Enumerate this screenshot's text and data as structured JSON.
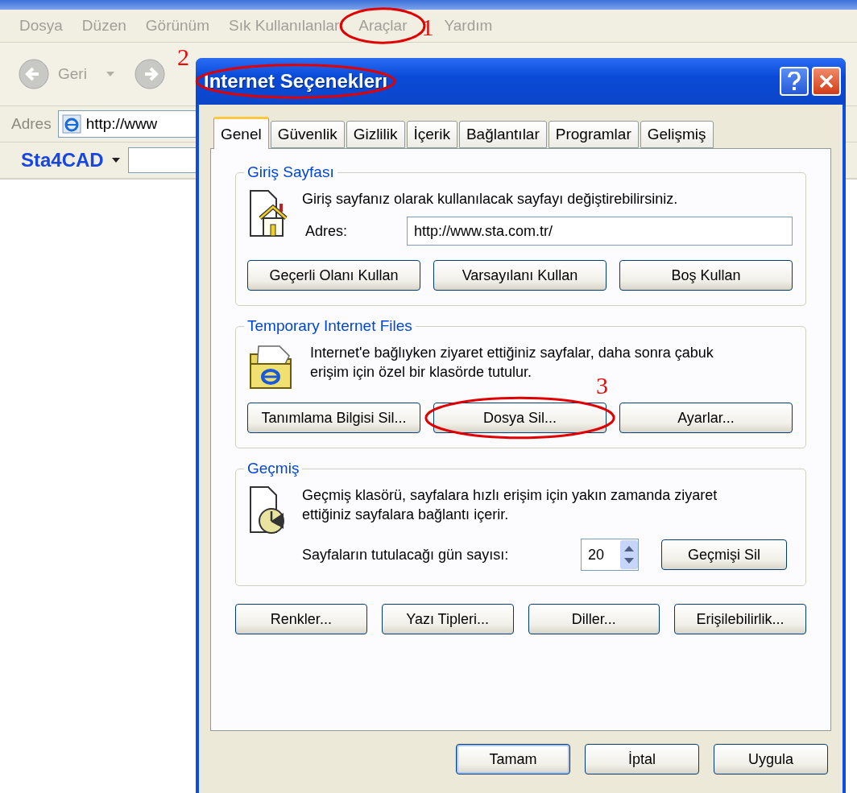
{
  "browser": {
    "menu": [
      {
        "label": "Dosya",
        "circled": false
      },
      {
        "label": "Düzen",
        "circled": false
      },
      {
        "label": "Görünüm",
        "circled": false
      },
      {
        "label": "Sık Kullanılanlar",
        "circled": false
      },
      {
        "label": "Araçlar",
        "circled": true,
        "marker": "1"
      },
      {
        "label": "Yardım",
        "circled": false
      }
    ],
    "back_label": "Geri",
    "forward_marker": "2",
    "address": {
      "label": "Adres",
      "value": "http://www"
    },
    "links": {
      "label": "Sta4CAD"
    }
  },
  "dialog": {
    "title": "Internet Seçenekleri",
    "title_circled": true,
    "tabs": [
      {
        "label": "Genel",
        "selected": true
      },
      {
        "label": "Güvenlik",
        "selected": false
      },
      {
        "label": "Gizlilik",
        "selected": false
      },
      {
        "label": "İçerik",
        "selected": false
      },
      {
        "label": "Bağlantılar",
        "selected": false
      },
      {
        "label": "Programlar",
        "selected": false
      },
      {
        "label": "Gelişmiş",
        "selected": false
      }
    ],
    "home": {
      "legend": "Giriş Sayfası",
      "text": "Giriş sayfanız olarak kullanılacak sayfayı değiştirebilirsiniz.",
      "address_label": "Adres:",
      "address_value": "http://www.sta.com.tr/",
      "buttons": [
        {
          "label": "Geçerli Olanı Kullan",
          "circled": false
        },
        {
          "label": "Varsayılanı Kullan",
          "circled": false
        },
        {
          "label": "Boş Kullan",
          "circled": false
        }
      ]
    },
    "temp": {
      "legend": "Temporary Internet Files",
      "text": "Internet'e bağlıyken ziyaret ettiğiniz sayfalar, daha sonra çabuk erişim için özel bir klasörde tutulur.",
      "buttons": [
        {
          "label": "Tanımlama Bilgisi Sil...",
          "circled": false
        },
        {
          "label": "Dosya Sil...",
          "circled": true,
          "marker": "3"
        },
        {
          "label": "Ayarlar...",
          "circled": false
        }
      ]
    },
    "history": {
      "legend": "Geçmiş",
      "text": "Geçmiş klasörü, sayfalara hızlı erişim için yakın zamanda ziyaret ettiğiniz sayfalara bağlantı içerir.",
      "days_label": "Sayfaların tutulacağı gün sayısı:",
      "days_value": "20",
      "button": "Geçmişi Sil"
    },
    "bottom_buttons": [
      {
        "label": "Renkler..."
      },
      {
        "label": "Yazı Tipleri..."
      },
      {
        "label": "Diller..."
      },
      {
        "label": "Erişilebilirlik..."
      }
    ],
    "footer_buttons": [
      {
        "label": "Tamam",
        "default": true
      },
      {
        "label": "İptal",
        "default": false
      },
      {
        "label": "Uygula",
        "default": false
      }
    ]
  }
}
